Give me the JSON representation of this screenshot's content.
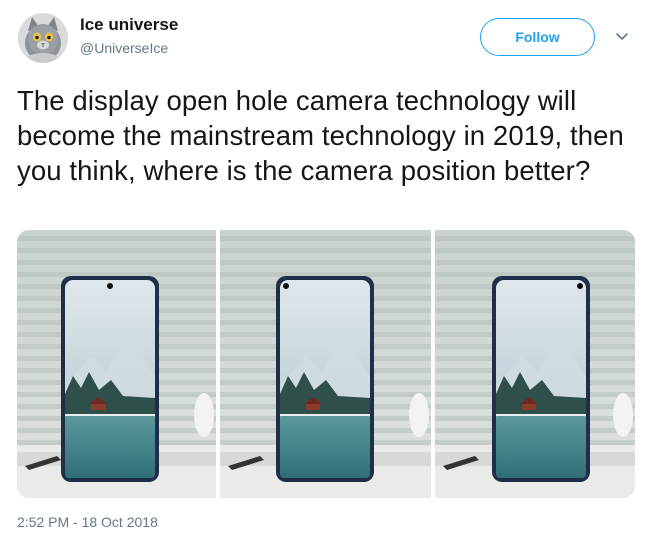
{
  "author": {
    "name": "Ice universe",
    "handle": "@UniverseIce"
  },
  "follow_label": "Follow",
  "tweet_text": "The display open hole camera technology will become the mainstream technology in 2019, then you think, where is the camera position better?",
  "media": {
    "images": [
      {
        "description": "phone-center-hole",
        "hole": "center"
      },
      {
        "description": "phone-left-hole",
        "hole": "left"
      },
      {
        "description": "phone-right-hole",
        "hole": "right"
      }
    ]
  },
  "timestamp": "2:52 PM - 18 Oct 2018",
  "colors": {
    "accent": "#1da1f2",
    "text": "#14171a",
    "muted": "#657786"
  }
}
